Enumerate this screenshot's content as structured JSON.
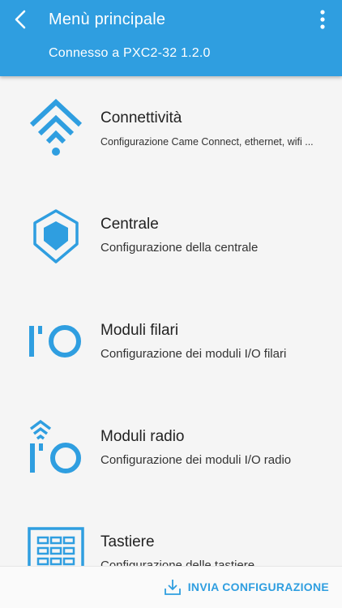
{
  "header": {
    "title": "Menù principale",
    "subtitle": "Connesso a PXC2-32 1.2.0",
    "back_icon": "chevron-left-icon",
    "menu_icon": "more-vertical-icon"
  },
  "menu": {
    "items": [
      {
        "label": "Connettività",
        "description": "Configurazione Came Connect, ethernet, wifi ...",
        "icon": "wifi-icon"
      },
      {
        "label": "Centrale",
        "description": "Configurazione della centrale",
        "icon": "shield-icon"
      },
      {
        "label": "Moduli filari",
        "description": "Configurazione dei moduli I/O filari",
        "icon": "io-icon"
      },
      {
        "label": "Moduli radio",
        "description": "Configurazione dei moduli I/O radio",
        "icon": "io-radio-icon"
      },
      {
        "label": "Tastiere",
        "description": "Configurazione delle tastiere",
        "icon": "keypad-icon"
      }
    ]
  },
  "footer": {
    "send_label": "INVIA CONFIGURAZIONE",
    "send_icon": "download-icon"
  },
  "colors": {
    "primary": "#2f9ee0",
    "background": "#f5f5f5"
  }
}
